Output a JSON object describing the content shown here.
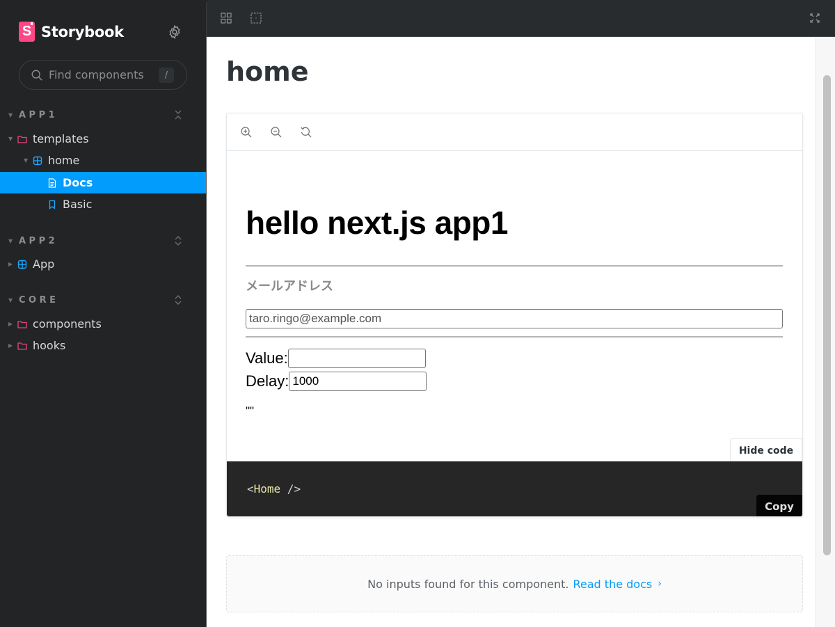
{
  "sidebar": {
    "brand": {
      "logo_letter": "S",
      "name": "Storybook"
    },
    "search": {
      "placeholder": "Find components",
      "shortcut": "/"
    },
    "sections": [
      {
        "label": "APP1",
        "items": [
          {
            "label": "templates",
            "type": "folder"
          },
          {
            "label": "home",
            "type": "component"
          },
          {
            "label": "Docs",
            "type": "docs",
            "selected": true
          },
          {
            "label": "Basic",
            "type": "story"
          }
        ]
      },
      {
        "label": "APP2",
        "items": [
          {
            "label": "App",
            "type": "component"
          }
        ]
      },
      {
        "label": "CORE",
        "items": [
          {
            "label": "components",
            "type": "folder"
          },
          {
            "label": "hooks",
            "type": "folder"
          }
        ]
      }
    ]
  },
  "main": {
    "page_title": "home",
    "story": {
      "heading": "hello next.js app1",
      "email_label": "メールアドレス",
      "email_value": "taro.ringo@example.com",
      "value_label": "Value:",
      "value_input": "",
      "delay_label": "Delay:",
      "delay_input": "1000",
      "output_text": "\"\""
    },
    "hide_code_label": "Hide code",
    "code": {
      "open": "<",
      "tag": "Home",
      "close": " />"
    },
    "copy_label": "Copy",
    "args_table": {
      "message": "No inputs found for this component.",
      "link_label": "Read the docs",
      "chevron": "›"
    }
  },
  "colors": {
    "accent": "#029cfd",
    "brand": "#ff4785",
    "folder": "#e8457d",
    "component": "#1ea7fd"
  }
}
